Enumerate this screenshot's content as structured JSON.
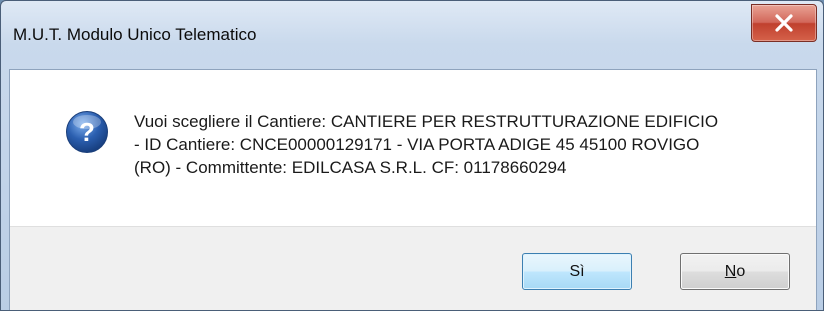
{
  "window": {
    "title": "M.U.T. Modulo Unico Telematico",
    "close_icon": "close-icon"
  },
  "dialog": {
    "icon": "question-icon",
    "message_lines": [
      "Vuoi scegliere il Cantiere: CANTIERE PER RESTRUTTURAZIONE EDIFICIO",
      "- ID Cantiere: CNCE00000129171 - VIA PORTA ADIGE 45 45100 ROVIGO",
      "(RO) -  Committente: EDILCASA S.R.L. CF: 01178660294"
    ]
  },
  "buttons": {
    "yes_label": "Sì",
    "no_mnemonic": "N",
    "no_rest": "o"
  },
  "colors": {
    "close_red": "#c0402e",
    "default_button_border": "#3c7fb1",
    "icon_blue": "#2b5fb0"
  }
}
